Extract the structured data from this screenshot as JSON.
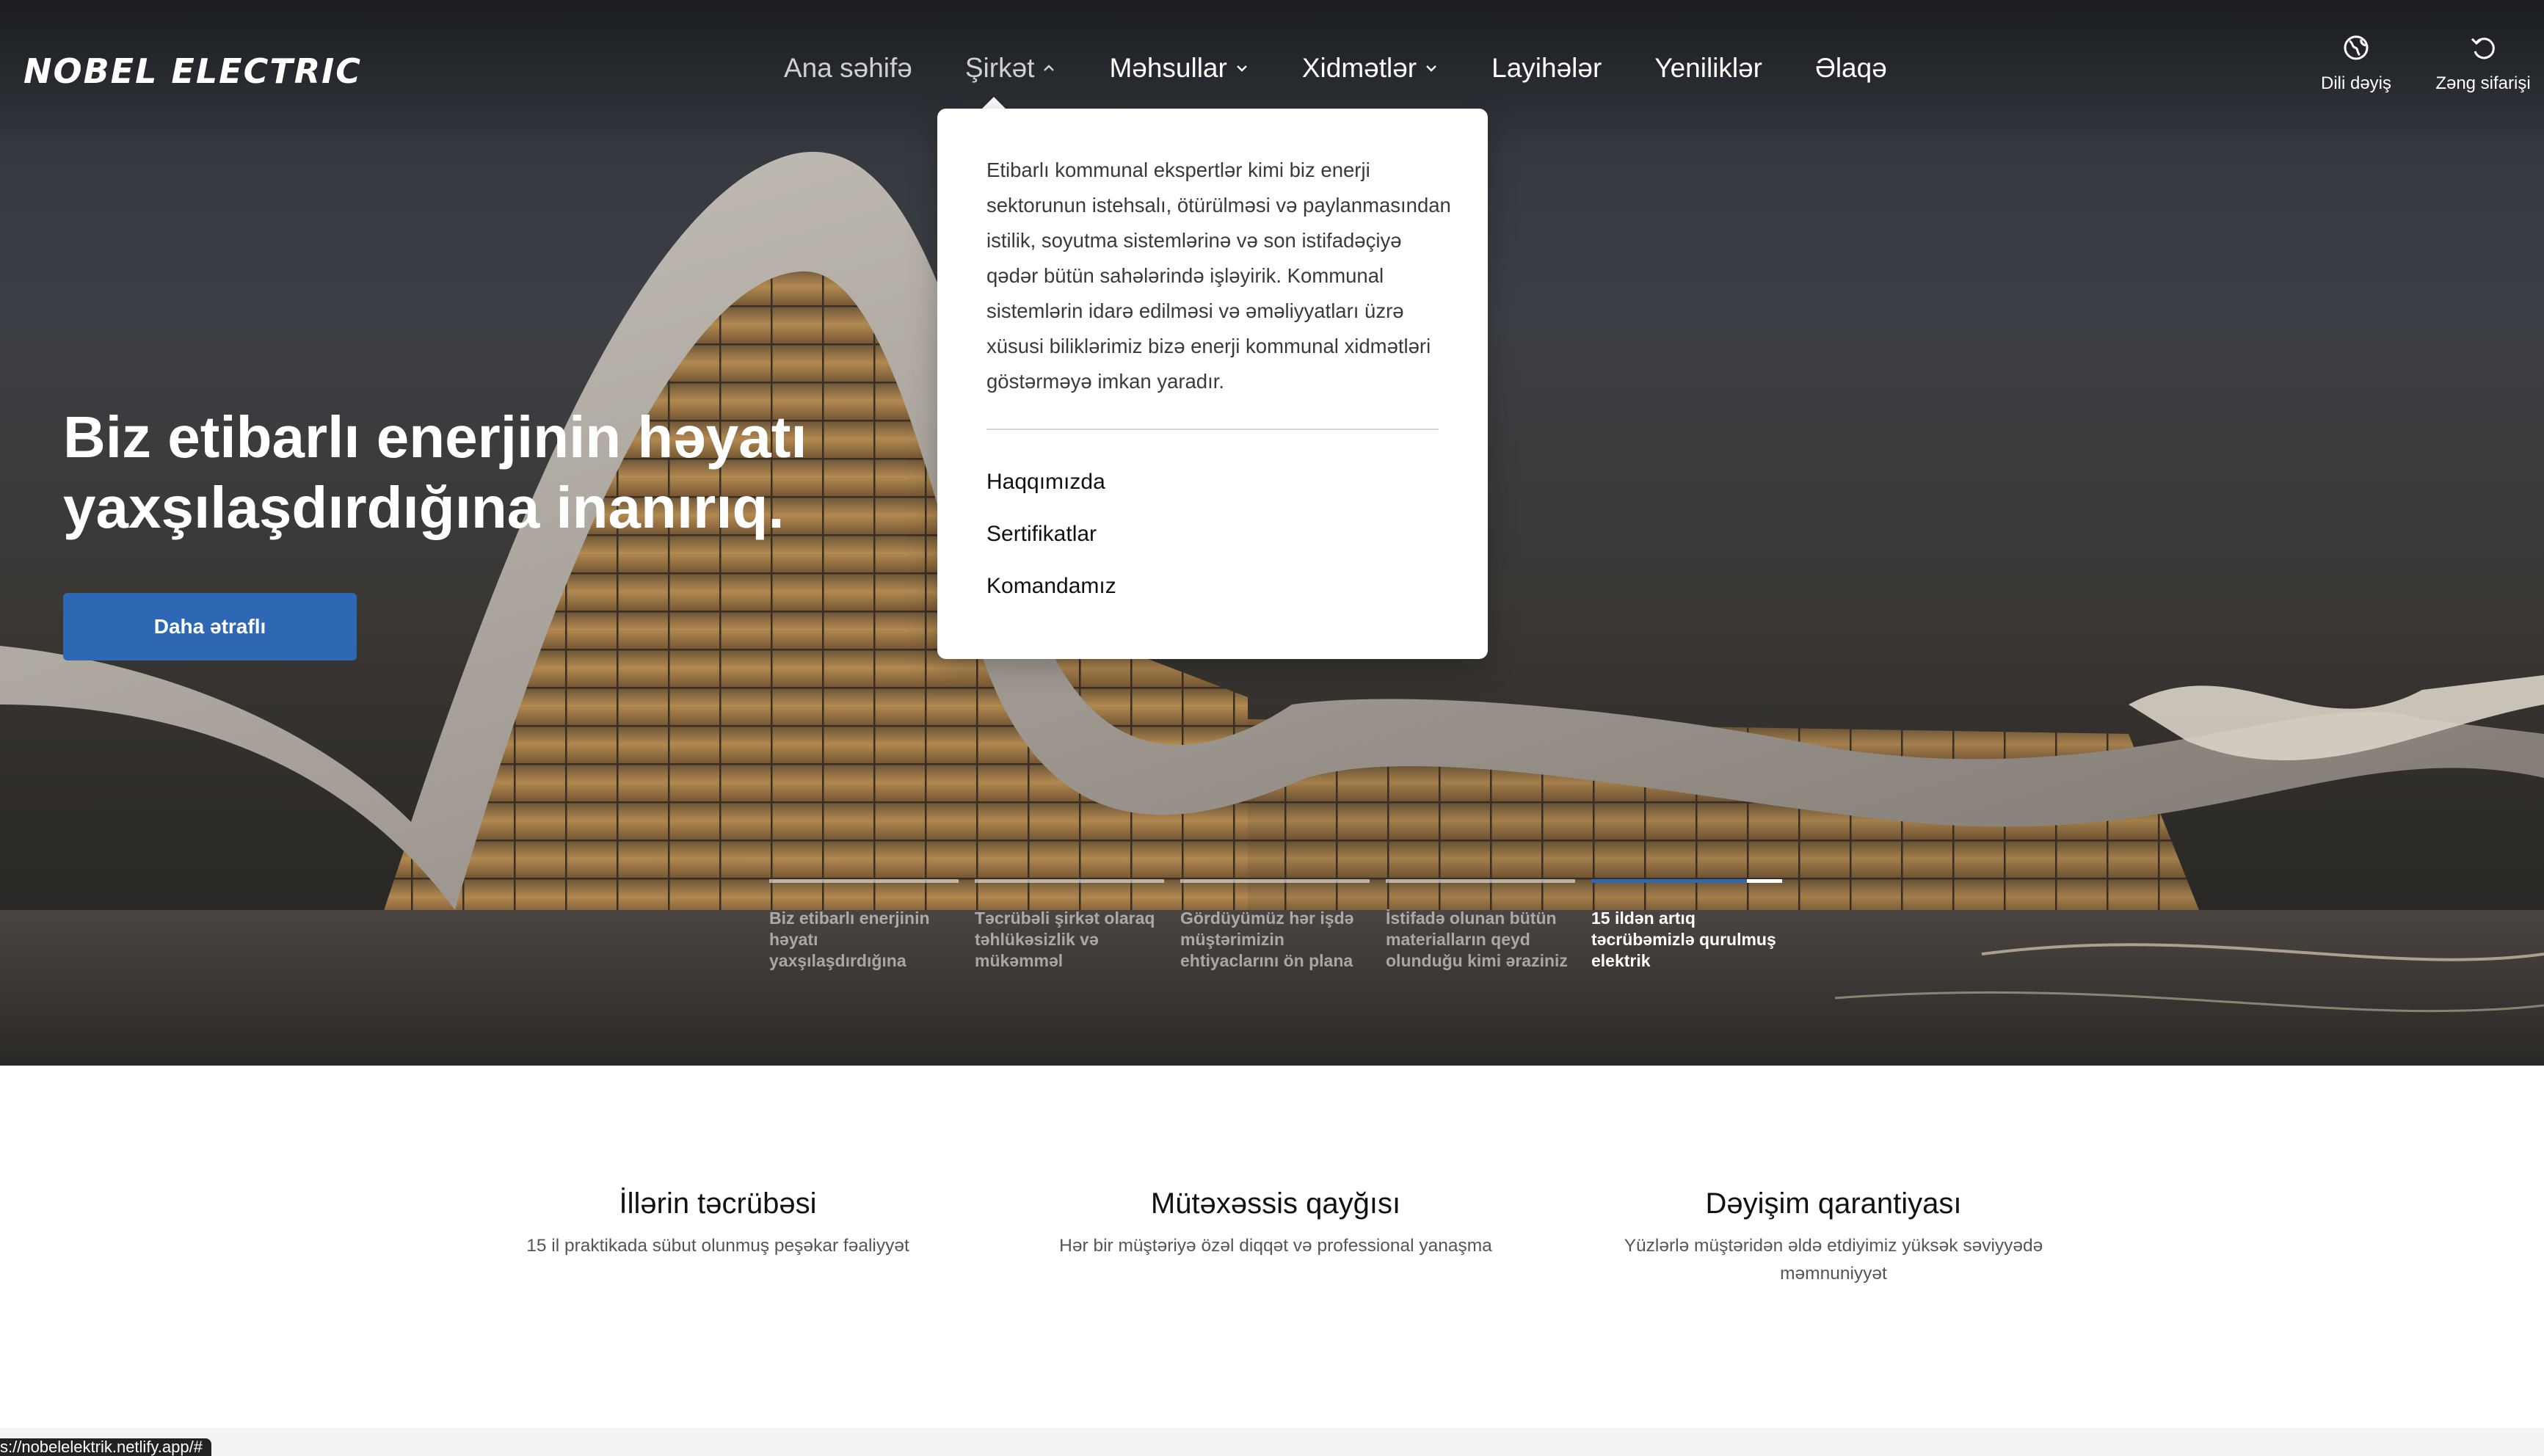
{
  "header": {
    "logo": "NOBEL ELECTRIC",
    "nav": [
      {
        "label": "Ana səhifə"
      },
      {
        "label": "Şirkət"
      },
      {
        "label": "Məhsullar"
      },
      {
        "label": "Xidmətlər"
      },
      {
        "label": "Layihələr"
      },
      {
        "label": "Yeniliklər"
      },
      {
        "label": "Əlaqə"
      }
    ],
    "language": {
      "label": "Dili dəyiş",
      "icon": "globe-icon"
    },
    "callback": {
      "label": "Zəng sifarişi",
      "icon": "phone-callback-icon"
    }
  },
  "dropdown": {
    "description": "Etibarlı kommunal ekspertlər kimi biz enerji sektorunun istehsalı, ötürülməsi və paylanmasından istilik, soyutma sistemlərinə və son istifadəçiyə qədər bütün sahələrində işləyirik. Kommunal sistemlərin idarə edilməsi və əməliyyatları üzrə xüsusi biliklərimiz bizə enerji kommunal xidmətləri göstərməyə imkan yaradır.",
    "links": [
      {
        "label": "Haqqımızda"
      },
      {
        "label": "Sertifikatlar"
      },
      {
        "label": "Komandamız"
      }
    ]
  },
  "hero": {
    "title": "Biz etibarlı enerjinin həyatı yaxşılaşdırdığına inanırıq.",
    "cta": "Daha ətraflı"
  },
  "slides": [
    {
      "text": "Biz etibarlı enerjinin həyatı yaxşılaşdırdığına",
      "progress": 0
    },
    {
      "text": "Təcrübəli şirkət olaraq təhlükəsizlik və mükəmməl",
      "progress": 0
    },
    {
      "text": "Gördüyümüz hər işdə müştərimizin ehtiyaclarını ön plana",
      "progress": 0
    },
    {
      "text": "İstifadə olunan bütün materialların qeyd olunduğu kimi əraziniz",
      "progress": 0
    },
    {
      "text": "15 ildən artıq təcrübəmizlə qurulmuş elektrik",
      "progress": 0.82
    }
  ],
  "features": [
    {
      "title": "İllərin təcrübəsi",
      "desc": "15 il praktikada sübut olunmuş peşəkar fəaliyyət"
    },
    {
      "title": "Mütəxəssis qayğısı",
      "desc": "Hər bir müştəriyə özəl diqqət və professional yanaşma"
    },
    {
      "title": "Dəyişim qarantiyası",
      "desc": "Yüzlərlə müştəridən əldə etdiyimiz yüksək səviyyədə məmnuniyyət"
    }
  ],
  "status_url": "s://nobelelektrik.netlify.app/#",
  "colors": {
    "accent": "#2e67b4",
    "dropdown_bg": "#ffffff"
  }
}
